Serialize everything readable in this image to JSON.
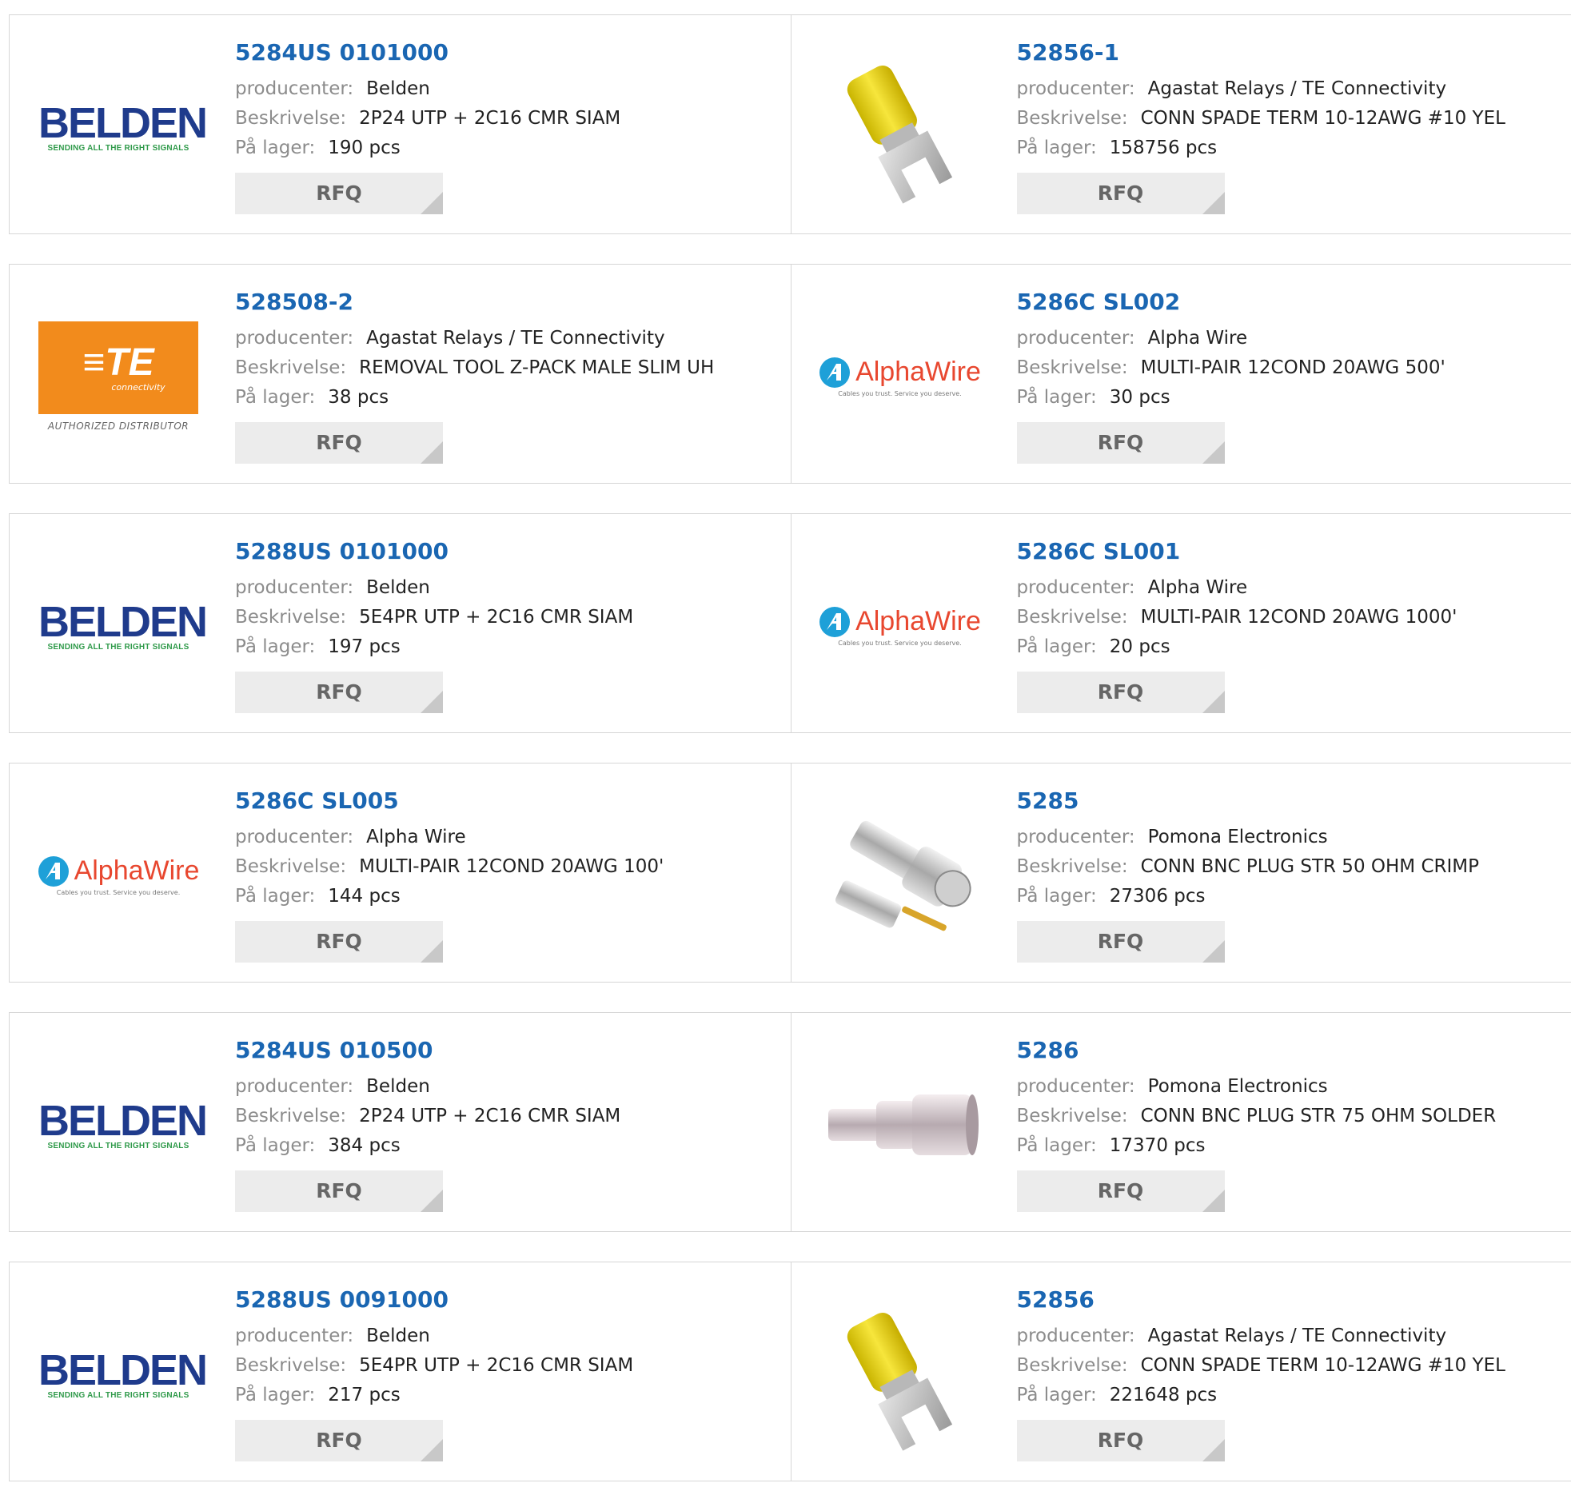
{
  "labels": {
    "manufacturer": "producenter:",
    "description": "Beskrivelse:",
    "stock": "På lager:",
    "rfq": "RFQ"
  },
  "logos": {
    "belden": {
      "wordmark": "BELDEN",
      "tagline": "SENDING ALL THE RIGHT SIGNALS",
      "color": "#1f3b8c",
      "tagline_color": "#2f9a4a"
    },
    "te": {
      "wordmark": "TE",
      "sub": "connectivity",
      "footer": "AUTHORIZED DISTRIBUTOR",
      "color": "#f28b1c"
    },
    "alpha": {
      "wordmark": "AlphaWire",
      "tagline": "Cables you trust. Service you deserve.",
      "color": "#e8472f"
    }
  },
  "colors": {
    "part_number": "#1a66b2",
    "label": "#8c8c8c",
    "button_bg": "#ececec"
  },
  "rows": [
    [
      {
        "part": "5284US 0101000",
        "manufacturer": "Belden",
        "description": "2P24 UTP + 2C16 CMR SIAM",
        "stock": "190 pcs",
        "image": "belden-logo"
      },
      {
        "part": "52856-1",
        "manufacturer": "Agastat Relays / TE Connectivity",
        "description": "CONN SPADE TERM 10-12AWG #10 YEL",
        "stock": "158756 pcs",
        "image": "yellow-spade-terminal-photo"
      }
    ],
    [
      {
        "part": "528508-2",
        "manufacturer": "Agastat Relays / TE Connectivity",
        "description": "REMOVAL TOOL Z-PACK MALE SLIM UH",
        "stock": "38 pcs",
        "image": "te-logo"
      },
      {
        "part": "5286C SL002",
        "manufacturer": "Alpha Wire",
        "description": "MULTI-PAIR 12COND 20AWG 500'",
        "stock": "30 pcs",
        "image": "alphawire-logo"
      }
    ],
    [
      {
        "part": "5288US 0101000",
        "manufacturer": "Belden",
        "description": "5E4PR UTP + 2C16 CMR SIAM",
        "stock": "197 pcs",
        "image": "belden-logo"
      },
      {
        "part": "5286C SL001",
        "manufacturer": "Alpha Wire",
        "description": "MULTI-PAIR 12COND 20AWG 1000'",
        "stock": "20 pcs",
        "image": "alphawire-logo"
      }
    ],
    [
      {
        "part": "5286C SL005",
        "manufacturer": "Alpha Wire",
        "description": "MULTI-PAIR 12COND 20AWG 100'",
        "stock": "144 pcs",
        "image": "alphawire-logo"
      },
      {
        "part": "5285",
        "manufacturer": "Pomona Electronics",
        "description": "CONN BNC PLUG STR 50 OHM CRIMP",
        "stock": "27306 pcs",
        "image": "bnc-crimp-connector-photo"
      }
    ],
    [
      {
        "part": "5284US 010500",
        "manufacturer": "Belden",
        "description": "2P24 UTP + 2C16 CMR SIAM",
        "stock": "384 pcs",
        "image": "belden-logo"
      },
      {
        "part": "5286",
        "manufacturer": "Pomona Electronics",
        "description": "CONN BNC PLUG STR 75 OHM SOLDER",
        "stock": "17370 pcs",
        "image": "bnc-solder-connector-photo"
      }
    ],
    [
      {
        "part": "5288US 0091000",
        "manufacturer": "Belden",
        "description": "5E4PR UTP + 2C16 CMR SIAM",
        "stock": "217 pcs",
        "image": "belden-logo"
      },
      {
        "part": "52856",
        "manufacturer": "Agastat Relays / TE Connectivity",
        "description": "CONN SPADE TERM 10-12AWG #10 YEL",
        "stock": "221648 pcs",
        "image": "yellow-spade-terminal-photo"
      }
    ]
  ]
}
